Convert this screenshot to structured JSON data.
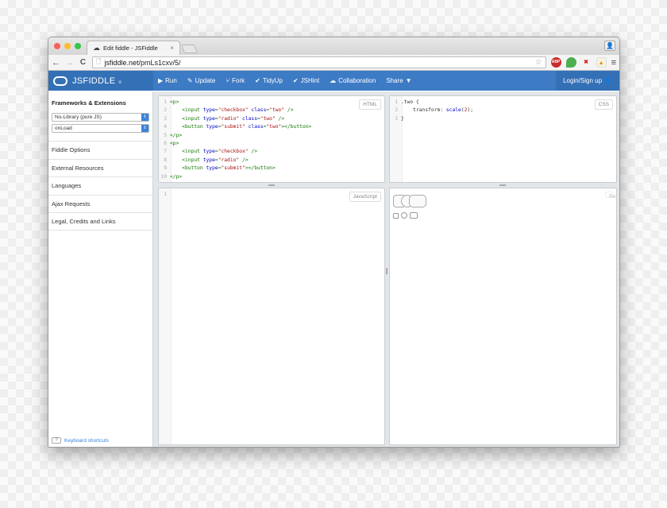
{
  "browser": {
    "tab_title": "Edit fiddle - JSFiddle",
    "tab_close": "×",
    "url_host": "jsfiddle.net",
    "url_path": "/pmLs1cxv/5/",
    "back_icon": "←",
    "forward_icon": "→",
    "reload_icon": "C",
    "star_icon": "☆",
    "ext_abp": "ABP",
    "ext_x": "✖",
    "menu_icon": "≡"
  },
  "jsfiddle": {
    "brand": "JSFIDDLE",
    "brand_suffix": "α",
    "actions": [
      {
        "icon": "▶",
        "label": "Run"
      },
      {
        "icon": "✎",
        "label": "Update"
      },
      {
        "icon": "⑂",
        "label": "Fork"
      },
      {
        "icon": "✔",
        "label": "TidyUp"
      },
      {
        "icon": "✔",
        "label": "JSHint"
      },
      {
        "icon": "☁",
        "label": "Collaboration"
      },
      {
        "icon": "▼",
        "label": "Share"
      }
    ],
    "login": "Login/Sign up"
  },
  "sidebar": {
    "title": "Frameworks & Extensions",
    "framework_select": "No-Library (pure JS)",
    "load_select": "onLoad",
    "items": [
      "Fiddle Options",
      "External Resources",
      "Languages",
      "Ajax Requests",
      "Legal, Credits and Links"
    ],
    "shortcut_key": "?",
    "shortcuts_label": "Keyboard shortcuts"
  },
  "panels": {
    "html_label": "HTML",
    "css_label": "CSS",
    "js_label": "JavaScript",
    "result_label": "Result"
  },
  "html_code": [
    {
      "n": "1",
      "parts": [
        [
          "tag",
          "<p>"
        ]
      ]
    },
    {
      "n": "2",
      "parts": [
        [
          "plain",
          "    "
        ],
        [
          "tag",
          "<input "
        ],
        [
          "attr",
          "type"
        ],
        [
          "tag",
          "="
        ],
        [
          "str",
          "\"checkbox\""
        ],
        [
          "tag",
          " "
        ],
        [
          "attr",
          "class"
        ],
        [
          "tag",
          "="
        ],
        [
          "str",
          "\"two\""
        ],
        [
          "tag",
          " />"
        ]
      ]
    },
    {
      "n": "3",
      "parts": [
        [
          "plain",
          "    "
        ],
        [
          "tag",
          "<input "
        ],
        [
          "attr",
          "type"
        ],
        [
          "tag",
          "="
        ],
        [
          "str",
          "\"radio\""
        ],
        [
          "tag",
          " "
        ],
        [
          "attr",
          "class"
        ],
        [
          "tag",
          "="
        ],
        [
          "str",
          "\"two\""
        ],
        [
          "tag",
          " />"
        ]
      ]
    },
    {
      "n": "4",
      "parts": [
        [
          "plain",
          "    "
        ],
        [
          "tag",
          "<button "
        ],
        [
          "attr",
          "type"
        ],
        [
          "tag",
          "="
        ],
        [
          "str",
          "\"submit\""
        ],
        [
          "tag",
          " "
        ],
        [
          "attr",
          "class"
        ],
        [
          "tag",
          "="
        ],
        [
          "str",
          "\"two\""
        ],
        [
          "tag",
          "></button>"
        ]
      ]
    },
    {
      "n": "5",
      "parts": [
        [
          "tag",
          "</p>"
        ]
      ]
    },
    {
      "n": "6",
      "parts": [
        [
          "tag",
          "<p>"
        ]
      ]
    },
    {
      "n": "7",
      "parts": [
        [
          "plain",
          "    "
        ],
        [
          "tag",
          "<input "
        ],
        [
          "attr",
          "type"
        ],
        [
          "tag",
          "="
        ],
        [
          "str",
          "\"checkbox\""
        ],
        [
          "tag",
          " />"
        ]
      ]
    },
    {
      "n": "8",
      "parts": [
        [
          "plain",
          "    "
        ],
        [
          "tag",
          "<input "
        ],
        [
          "attr",
          "type"
        ],
        [
          "tag",
          "="
        ],
        [
          "str",
          "\"radio\""
        ],
        [
          "tag",
          " />"
        ]
      ]
    },
    {
      "n": "9",
      "parts": [
        [
          "plain",
          "    "
        ],
        [
          "tag",
          "<button "
        ],
        [
          "attr",
          "type"
        ],
        [
          "tag",
          "="
        ],
        [
          "str",
          "\"submit\""
        ],
        [
          "tag",
          "></button>"
        ]
      ]
    },
    {
      "n": "10",
      "parts": [
        [
          "tag",
          "</p>"
        ]
      ]
    }
  ],
  "css_code": [
    {
      "n": "1",
      "parts": [
        [
          "sel",
          ".two {"
        ]
      ]
    },
    {
      "n": "2",
      "parts": [
        [
          "plain",
          "    "
        ],
        [
          "prop",
          "transform"
        ],
        [
          "plain",
          ": "
        ],
        [
          "attr",
          "scale"
        ],
        [
          "plain",
          "("
        ],
        [
          "str",
          "2"
        ],
        [
          "plain",
          ");"
        ]
      ]
    },
    {
      "n": "3",
      "parts": [
        [
          "sel",
          "}"
        ]
      ]
    }
  ],
  "js_code": [
    {
      "n": "1",
      "parts": []
    }
  ],
  "colors": {
    "jsfiddle_blue": "#3d7bc4",
    "light_red": "#fc5f57",
    "light_yellow": "#fdbc2e",
    "light_green": "#33c748"
  }
}
